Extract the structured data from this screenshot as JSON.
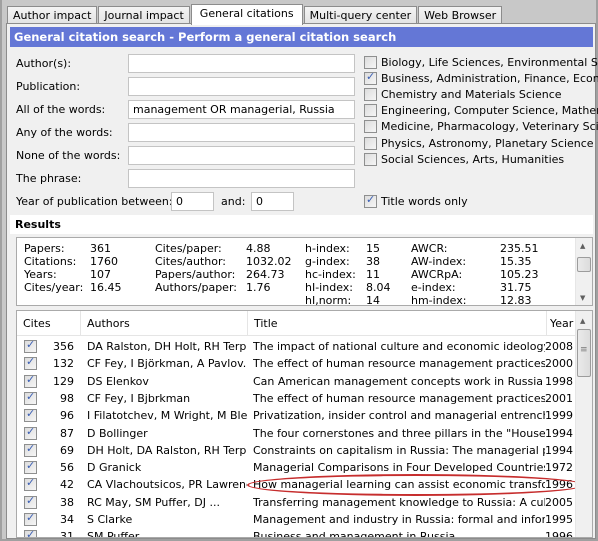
{
  "tabs": [
    {
      "label": "Author impact",
      "active": false
    },
    {
      "label": "Journal impact",
      "active": false
    },
    {
      "label": "General citations",
      "active": true
    },
    {
      "label": "Multi-query center",
      "active": false
    },
    {
      "label": "Web Browser",
      "active": false
    }
  ],
  "header": {
    "title": "General citation search - Perform a general citation search"
  },
  "form": {
    "authors": {
      "label": "Author(s):",
      "value": ""
    },
    "publication": {
      "label": "Publication:",
      "value": ""
    },
    "all_words": {
      "label": "All of the words:",
      "value": "management OR managerial, Russia"
    },
    "any_words": {
      "label": "Any of the words:",
      "value": ""
    },
    "none_words": {
      "label": "None of the words:",
      "value": ""
    },
    "phrase": {
      "label": "The phrase:",
      "value": ""
    },
    "year_between": {
      "label": "Year of publication between:",
      "from": "0",
      "and_label": "and:",
      "to": "0"
    },
    "title_only": {
      "label": "Title words only",
      "checked": true
    }
  },
  "subjects": [
    {
      "label": "Biology, Life Sciences, Environmental Science",
      "checked": false
    },
    {
      "label": "Business, Administration, Finance, Economics",
      "checked": true
    },
    {
      "label": "Chemistry and Materials Science",
      "checked": false
    },
    {
      "label": "Engineering, Computer Science, Mathematics",
      "checked": false
    },
    {
      "label": "Medicine, Pharmacology, Veterinary Science",
      "checked": false
    },
    {
      "label": "Physics, Astronomy, Planetary Science",
      "checked": false
    },
    {
      "label": "Social Sciences, Arts, Humanities",
      "checked": false
    }
  ],
  "results": {
    "title": "Results",
    "stats": [
      [
        {
          "k": "Papers:",
          "v": "361"
        },
        {
          "k": "Citations:",
          "v": "1760"
        },
        {
          "k": "Years:",
          "v": "107"
        },
        {
          "k": "Cites/year:",
          "v": "16.45"
        }
      ],
      [
        {
          "k": "Cites/paper:",
          "v": "4.88"
        },
        {
          "k": "Cites/author:",
          "v": "1032.02"
        },
        {
          "k": "Papers/author:",
          "v": "264.73"
        },
        {
          "k": "Authors/paper:",
          "v": "1.76"
        }
      ],
      [
        {
          "k": "h-index:",
          "v": "15"
        },
        {
          "k": "g-index:",
          "v": "38"
        },
        {
          "k": "hc-index:",
          "v": "11"
        },
        {
          "k": "hI-index:",
          "v": "8.04"
        },
        {
          "k": "hI,norm:",
          "v": "14"
        }
      ],
      [
        {
          "k": "AWCR:",
          "v": "235.51"
        },
        {
          "k": "AW-index:",
          "v": "15.35"
        },
        {
          "k": "AWCRpA:",
          "v": "105.23"
        },
        {
          "k": "e-index:",
          "v": "31.75"
        },
        {
          "k": "hm-index:",
          "v": "12.83"
        }
      ]
    ]
  },
  "list": {
    "columns": [
      "Cites",
      "Authors",
      "Title",
      "Year"
    ],
    "rows": [
      {
        "checked": true,
        "cites": "356",
        "authors": "DA Ralston, DH Holt, RH Terp...",
        "title": "The impact of national culture and economic ideology o...",
        "year": "2008"
      },
      {
        "checked": true,
        "cites": "132",
        "authors": "CF Fey, I Björkman, A Pavlov...",
        "title": "The effect of human resource management practices o...",
        "year": "2000"
      },
      {
        "checked": true,
        "cites": "129",
        "authors": "DS Elenkov",
        "title": "Can American management concepts work in Russia",
        "year": "1998"
      },
      {
        "checked": true,
        "cites": "98",
        "authors": "CF Fey, I Bjbrkman",
        "title": "The effect of human resource management practices o...",
        "year": "2001"
      },
      {
        "checked": true,
        "cites": "96",
        "authors": "I Filatotchev, M Wright, M Ble...",
        "title": "Privatization, insider control and managerial entrenchm...",
        "year": "1999"
      },
      {
        "checked": true,
        "cites": "87",
        "authors": "D Bollinger",
        "title": "The four cornerstones and three pillars in the \"House of...",
        "year": "1994"
      },
      {
        "checked": true,
        "cites": "69",
        "authors": "DH Holt, DA Ralston, RH Terp...",
        "title": "Constraints on capitalism in Russia: The managerial psy...",
        "year": "1994"
      },
      {
        "checked": true,
        "cites": "56",
        "authors": "D Granick",
        "title": "Managerial Comparisons in Four Developed Countries: ...",
        "year": "1972",
        "highlighted": true
      },
      {
        "checked": true,
        "cites": "42",
        "authors": "CA Vlachoutsicos, PR Lawrence",
        "title": "How managerial learning can assist economic transform...",
        "year": "1996"
      },
      {
        "checked": true,
        "cites": "38",
        "authors": "RC May, SM Puffer, DJ ...",
        "title": "Transferring management knowledge to Russia: A cultu...",
        "year": "2005"
      },
      {
        "checked": true,
        "cites": "34",
        "authors": "S Clarke",
        "title": "Management and industry in Russia: formal and informa...",
        "year": "1995"
      },
      {
        "checked": true,
        "cites": "31",
        "authors": "SM Puffer...",
        "title": "Business and management in Russia",
        "year": "1996"
      }
    ]
  },
  "colors": {
    "header_bar": "#6477d6",
    "highlight_oval": "#c62d2d",
    "check": "#3b5fb4"
  }
}
